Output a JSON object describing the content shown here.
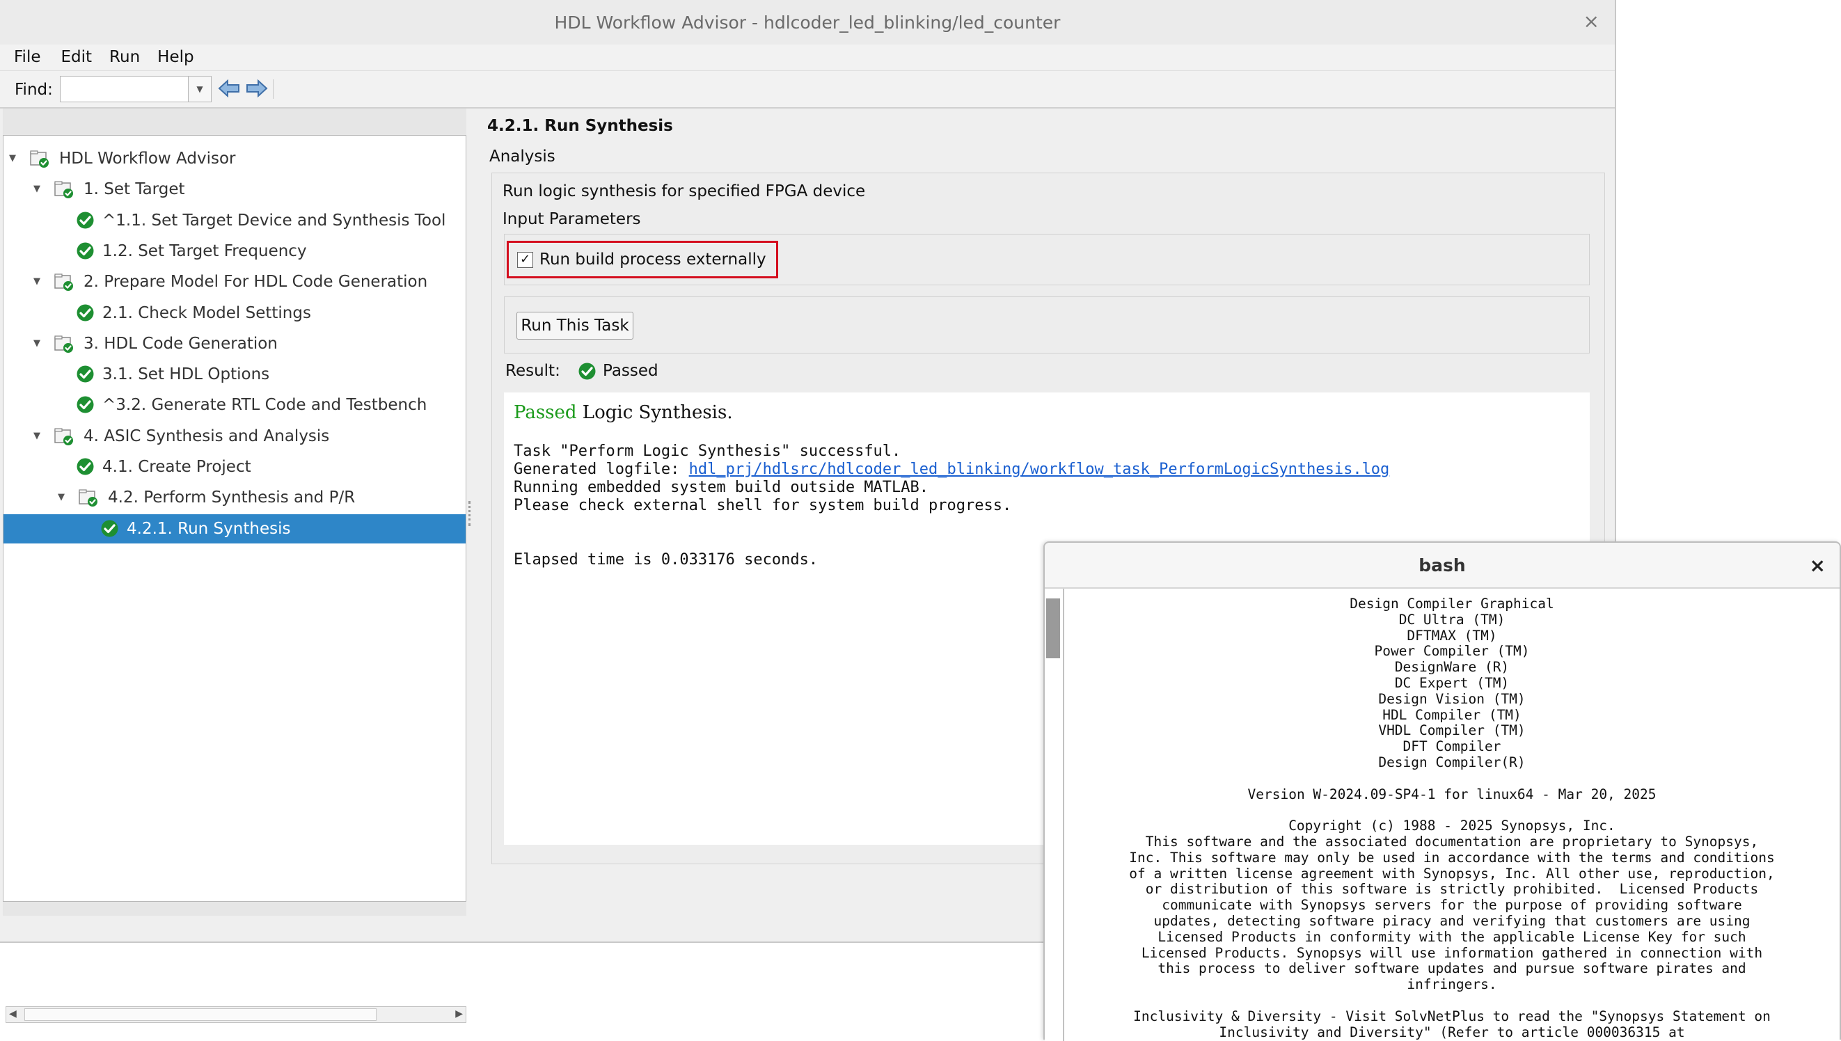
{
  "window": {
    "title": "HDL Workflow Advisor - hdlcoder_led_blinking/led_counter",
    "close": "×"
  },
  "menu": [
    "File",
    "Edit",
    "Run",
    "Help"
  ],
  "toolbar": {
    "find_label": "Find:",
    "find_value": "",
    "dropdown": "▼"
  },
  "tree": [
    {
      "label": "HDL Workflow Advisor",
      "level": 0,
      "kind": "folder",
      "expanded": true
    },
    {
      "label": "1. Set Target",
      "level": 1,
      "kind": "folder",
      "expanded": true
    },
    {
      "label": "^1.1. Set Target Device and Synthesis Tool",
      "level": 2,
      "kind": "task"
    },
    {
      "label": "1.2. Set Target Frequency",
      "level": 2,
      "kind": "task"
    },
    {
      "label": "2. Prepare Model For HDL Code Generation",
      "level": 1,
      "kind": "folder",
      "expanded": true
    },
    {
      "label": "2.1. Check Model Settings",
      "level": 2,
      "kind": "task"
    },
    {
      "label": "3. HDL Code Generation",
      "level": 1,
      "kind": "folder",
      "expanded": true
    },
    {
      "label": "3.1. Set HDL Options",
      "level": 2,
      "kind": "task"
    },
    {
      "label": "^3.2. Generate RTL Code and Testbench",
      "level": 2,
      "kind": "task"
    },
    {
      "label": "4. ASIC Synthesis and Analysis",
      "level": 1,
      "kind": "folder",
      "expanded": true
    },
    {
      "label": "4.1. Create Project",
      "level": 2,
      "kind": "task"
    },
    {
      "label": "4.2. Perform Synthesis and P/R",
      "level": 2,
      "kind": "folder",
      "expanded": true
    },
    {
      "label": "4.2.1. Run Synthesis",
      "level": 3,
      "kind": "task",
      "selected": true
    }
  ],
  "detail": {
    "title": "4.2.1. Run Synthesis",
    "analysis_label": "Analysis",
    "description": "Run logic synthesis for specified FPGA device",
    "input_params_label": "Input Parameters",
    "checkbox_label": "Run build process externally",
    "checkbox_checked": true,
    "checkbox_mark": "✓",
    "run_button": "Run This Task",
    "result_label": "Result:",
    "result_value": "Passed"
  },
  "report": {
    "status_word": "Passed",
    "heading_rest": " Logic Synthesis.",
    "line1": "Task \"Perform Logic Synthesis\" successful.",
    "logfile_prefix": "Generated logfile: ",
    "logfile_link": "hdl_prj/hdlsrc/hdlcoder_led_blinking/workflow_task_PerformLogicSynthesis.log",
    "line3": "Running embedded system build outside MATLAB.",
    "line4": "Please check external shell for system build progress.",
    "elapsed": "Elapsed time is 0.033176 seconds."
  },
  "bash": {
    "title": "bash",
    "close": "×",
    "lines": [
      "Design Compiler Graphical",
      "DC Ultra (TM)",
      "DFTMAX (TM)",
      "Power Compiler (TM)",
      "DesignWare (R)",
      "DC Expert (TM)",
      "Design Vision (TM)",
      "HDL Compiler (TM)",
      "VHDL Compiler (TM)",
      "DFT Compiler",
      "Design Compiler(R)",
      "",
      "Version W-2024.09-SP4-1 for linux64 - Mar 20, 2025",
      "",
      "Copyright (c) 1988 - 2025 Synopsys, Inc.",
      "This software and the associated documentation are proprietary to Synopsys,",
      "Inc. This software may only be used in accordance with the terms and conditions",
      "of a written license agreement with Synopsys, Inc. All other use, reproduction,",
      "or distribution of this software is strictly prohibited.  Licensed Products",
      "communicate with Synopsys servers for the purpose of providing software",
      "updates, detecting software piracy and verifying that customers are using",
      "Licensed Products in conformity with the applicable License Key for such",
      "Licensed Products. Synopsys will use information gathered in connection with",
      "this process to deliver software updates and pursue software pirates and",
      "infringers.",
      "",
      "Inclusivity & Diversity - Visit SolvNetPlus to read the \"Synopsys Statement on",
      "Inclusivity and Diversity\" (Refer to article 000036315 at"
    ]
  },
  "colors": {
    "selection": "#2e86c8",
    "pass_green": "#1a9a1a",
    "highlight_red": "#d40f1f",
    "link": "#1a5fd0"
  },
  "icons": {
    "check": "check-circle-icon",
    "folder": "folder-check-icon",
    "back": "back-arrow-icon",
    "forward": "forward-arrow-icon"
  }
}
